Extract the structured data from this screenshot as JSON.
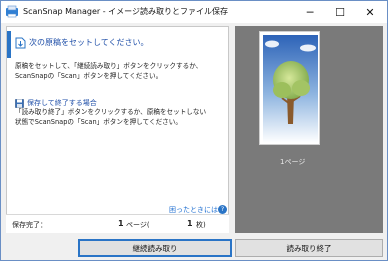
{
  "window": {
    "title": "ScanSnap Manager - イメージ読み取りとファイル保存",
    "minimize_glyph": "─",
    "maximize_glyph": "☐",
    "close_glyph": "✕"
  },
  "instructions": {
    "title": "次の原稿をセットしてください。",
    "body_lines": [
      "原稿をセットして、「継続読み取り」ボタンをクリックするか、",
      "ScanSnapの「Scan」ボタンを押してください。"
    ],
    "icon": "document-arrow-icon"
  },
  "save_section": {
    "title": "保存して終了する場合",
    "body_lines": [
      "「読み取り終了」ボタンをクリックするか、原稿をセットしない",
      "状態でScanSnapの「Scan」ボタンを押してください。"
    ],
    "icon": "save-icon"
  },
  "help": {
    "link_text": "困ったときには",
    "icon_glyph": "?"
  },
  "status": {
    "label": "保存完了：",
    "pages_value": "1",
    "pages_unit": "ページ(",
    "sheets_value": "1",
    "sheets_unit": "枚)"
  },
  "preview": {
    "page_label": "1ページ"
  },
  "buttons": {
    "continue_label": "継続読み取り",
    "finish_label": "読み取り終了"
  },
  "colors": {
    "accent": "#2a74c6",
    "preview_bg": "#7a7a7a",
    "link": "#1f6fd1"
  }
}
